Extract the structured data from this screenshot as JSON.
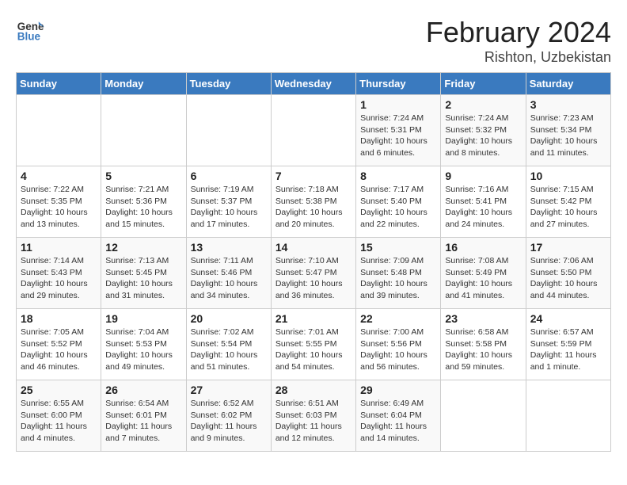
{
  "header": {
    "logo_general": "General",
    "logo_blue": "Blue",
    "month_year": "February 2024",
    "location": "Rishton, Uzbekistan"
  },
  "days_of_week": [
    "Sunday",
    "Monday",
    "Tuesday",
    "Wednesday",
    "Thursday",
    "Friday",
    "Saturday"
  ],
  "weeks": [
    [
      {
        "day": "",
        "info": ""
      },
      {
        "day": "",
        "info": ""
      },
      {
        "day": "",
        "info": ""
      },
      {
        "day": "",
        "info": ""
      },
      {
        "day": "1",
        "info": "Sunrise: 7:24 AM\nSunset: 5:31 PM\nDaylight: 10 hours\nand 6 minutes."
      },
      {
        "day": "2",
        "info": "Sunrise: 7:24 AM\nSunset: 5:32 PM\nDaylight: 10 hours\nand 8 minutes."
      },
      {
        "day": "3",
        "info": "Sunrise: 7:23 AM\nSunset: 5:34 PM\nDaylight: 10 hours\nand 11 minutes."
      }
    ],
    [
      {
        "day": "4",
        "info": "Sunrise: 7:22 AM\nSunset: 5:35 PM\nDaylight: 10 hours\nand 13 minutes."
      },
      {
        "day": "5",
        "info": "Sunrise: 7:21 AM\nSunset: 5:36 PM\nDaylight: 10 hours\nand 15 minutes."
      },
      {
        "day": "6",
        "info": "Sunrise: 7:19 AM\nSunset: 5:37 PM\nDaylight: 10 hours\nand 17 minutes."
      },
      {
        "day": "7",
        "info": "Sunrise: 7:18 AM\nSunset: 5:38 PM\nDaylight: 10 hours\nand 20 minutes."
      },
      {
        "day": "8",
        "info": "Sunrise: 7:17 AM\nSunset: 5:40 PM\nDaylight: 10 hours\nand 22 minutes."
      },
      {
        "day": "9",
        "info": "Sunrise: 7:16 AM\nSunset: 5:41 PM\nDaylight: 10 hours\nand 24 minutes."
      },
      {
        "day": "10",
        "info": "Sunrise: 7:15 AM\nSunset: 5:42 PM\nDaylight: 10 hours\nand 27 minutes."
      }
    ],
    [
      {
        "day": "11",
        "info": "Sunrise: 7:14 AM\nSunset: 5:43 PM\nDaylight: 10 hours\nand 29 minutes."
      },
      {
        "day": "12",
        "info": "Sunrise: 7:13 AM\nSunset: 5:45 PM\nDaylight: 10 hours\nand 31 minutes."
      },
      {
        "day": "13",
        "info": "Sunrise: 7:11 AM\nSunset: 5:46 PM\nDaylight: 10 hours\nand 34 minutes."
      },
      {
        "day": "14",
        "info": "Sunrise: 7:10 AM\nSunset: 5:47 PM\nDaylight: 10 hours\nand 36 minutes."
      },
      {
        "day": "15",
        "info": "Sunrise: 7:09 AM\nSunset: 5:48 PM\nDaylight: 10 hours\nand 39 minutes."
      },
      {
        "day": "16",
        "info": "Sunrise: 7:08 AM\nSunset: 5:49 PM\nDaylight: 10 hours\nand 41 minutes."
      },
      {
        "day": "17",
        "info": "Sunrise: 7:06 AM\nSunset: 5:50 PM\nDaylight: 10 hours\nand 44 minutes."
      }
    ],
    [
      {
        "day": "18",
        "info": "Sunrise: 7:05 AM\nSunset: 5:52 PM\nDaylight: 10 hours\nand 46 minutes."
      },
      {
        "day": "19",
        "info": "Sunrise: 7:04 AM\nSunset: 5:53 PM\nDaylight: 10 hours\nand 49 minutes."
      },
      {
        "day": "20",
        "info": "Sunrise: 7:02 AM\nSunset: 5:54 PM\nDaylight: 10 hours\nand 51 minutes."
      },
      {
        "day": "21",
        "info": "Sunrise: 7:01 AM\nSunset: 5:55 PM\nDaylight: 10 hours\nand 54 minutes."
      },
      {
        "day": "22",
        "info": "Sunrise: 7:00 AM\nSunset: 5:56 PM\nDaylight: 10 hours\nand 56 minutes."
      },
      {
        "day": "23",
        "info": "Sunrise: 6:58 AM\nSunset: 5:58 PM\nDaylight: 10 hours\nand 59 minutes."
      },
      {
        "day": "24",
        "info": "Sunrise: 6:57 AM\nSunset: 5:59 PM\nDaylight: 11 hours\nand 1 minute."
      }
    ],
    [
      {
        "day": "25",
        "info": "Sunrise: 6:55 AM\nSunset: 6:00 PM\nDaylight: 11 hours\nand 4 minutes."
      },
      {
        "day": "26",
        "info": "Sunrise: 6:54 AM\nSunset: 6:01 PM\nDaylight: 11 hours\nand 7 minutes."
      },
      {
        "day": "27",
        "info": "Sunrise: 6:52 AM\nSunset: 6:02 PM\nDaylight: 11 hours\nand 9 minutes."
      },
      {
        "day": "28",
        "info": "Sunrise: 6:51 AM\nSunset: 6:03 PM\nDaylight: 11 hours\nand 12 minutes."
      },
      {
        "day": "29",
        "info": "Sunrise: 6:49 AM\nSunset: 6:04 PM\nDaylight: 11 hours\nand 14 minutes."
      },
      {
        "day": "",
        "info": ""
      },
      {
        "day": "",
        "info": ""
      }
    ]
  ]
}
